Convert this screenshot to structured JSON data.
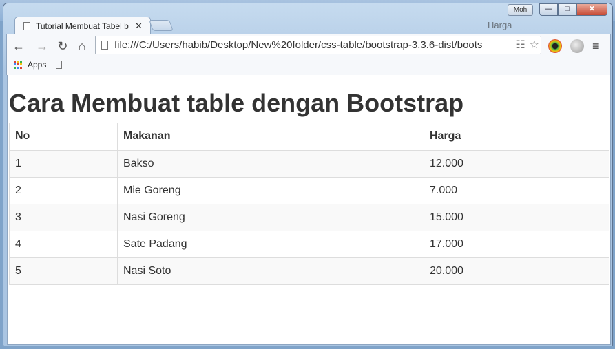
{
  "window": {
    "user_badge": "Moh",
    "minimize": "—",
    "maximize": "□",
    "close": "✕"
  },
  "background": {
    "harga": "Harga"
  },
  "tab": {
    "title": "Tutorial Membuat Tabel b",
    "close": "✕"
  },
  "toolbar": {
    "back": "←",
    "forward": "→",
    "reload": "↻",
    "home": "⌂",
    "url": "file:///C:/Users/habib/Desktop/New%20folder/css-table/bootstrap-3.3.6-dist/boots",
    "menu": "≡"
  },
  "bookmarks": {
    "apps": "Apps"
  },
  "page": {
    "heading": "Cara Membuat table dengan Bootstrap",
    "table": {
      "headers": [
        "No",
        "Makanan",
        "Harga"
      ],
      "rows": [
        [
          "1",
          "Bakso",
          "12.000"
        ],
        [
          "2",
          "Mie Goreng",
          "7.000"
        ],
        [
          "3",
          "Nasi Goreng",
          "15.000"
        ],
        [
          "4",
          "Sate Padang",
          "17.000"
        ],
        [
          "5",
          "Nasi Soto",
          "20.000"
        ]
      ]
    }
  }
}
